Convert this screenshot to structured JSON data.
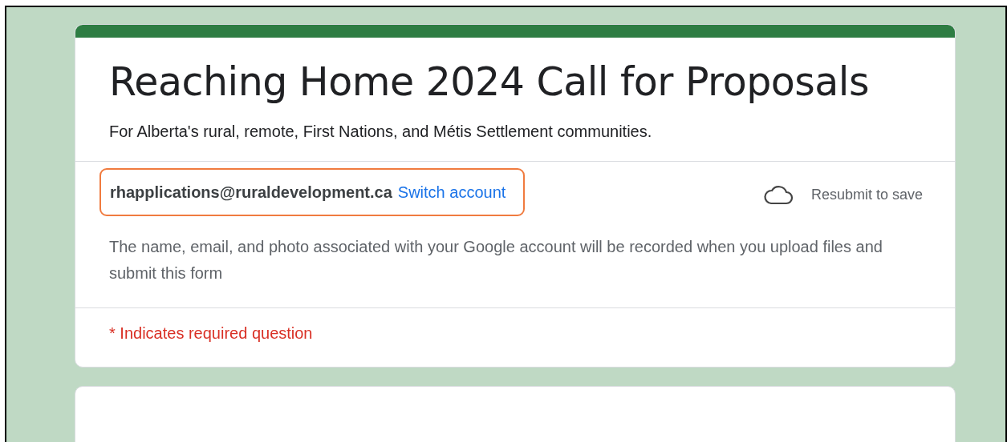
{
  "form": {
    "title": "Reaching Home 2024 Call for Proposals",
    "description": "For Alberta's rural, remote, First Nations, and Métis Settlement communities."
  },
  "account": {
    "email": "rhapplications@ruraldevelopment.ca",
    "switch_link": "Switch account",
    "highlighted": true,
    "save_status": "Resubmit to save"
  },
  "notice": "The name, email, and photo associated with your Google account will be recorded when you upload files and submit this form",
  "required_note": "* Indicates required question"
}
